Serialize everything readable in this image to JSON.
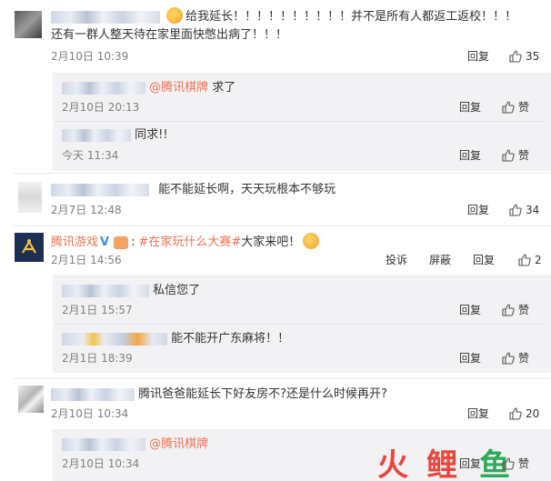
{
  "actions": {
    "reply": "回复",
    "like": "赞",
    "report": "投诉",
    "block": "屏蔽"
  },
  "comments": [
    {
      "text1": "给我延长！！！！！！！！！！并不是所有人都返工返校！！！",
      "text2": "还有一群人整天待在家里面快憋出病了！！！",
      "time": "2月10日 10:39",
      "likes": "35"
    },
    {
      "text": "能不能延长啊，天天玩根本不够玩",
      "time": "2月7日 12:48",
      "likes": "34"
    },
    {
      "user": "腾讯游戏",
      "hashtag": "#在家玩什么大赛#",
      "text": "大家来吧！",
      "time": "2月1日 14:56",
      "likes": "2"
    },
    {
      "text": "腾讯爸爸能延长下好友房不?还是什么时候再开?",
      "time": "2月10日 10:34",
      "likes": "20"
    }
  ],
  "replies": [
    {
      "mention": "@腾讯棋牌",
      "text": "求了",
      "time": "2月10日 20:13"
    },
    {
      "text": "同求!!",
      "time": "今天 11:34"
    },
    {
      "text": "私信您了",
      "time": "2月1日 15:57"
    },
    {
      "text": "能不能开广东麻将！！",
      "time": "2月1日 18:39"
    },
    {
      "mention": "@腾讯棋牌",
      "time": "2月10日 10:34"
    }
  ],
  "watermark": "火鲤鱼",
  "colors": {
    "link": "#eb7350",
    "reply_bg": "#f2f2f5",
    "muted": "#808080"
  }
}
